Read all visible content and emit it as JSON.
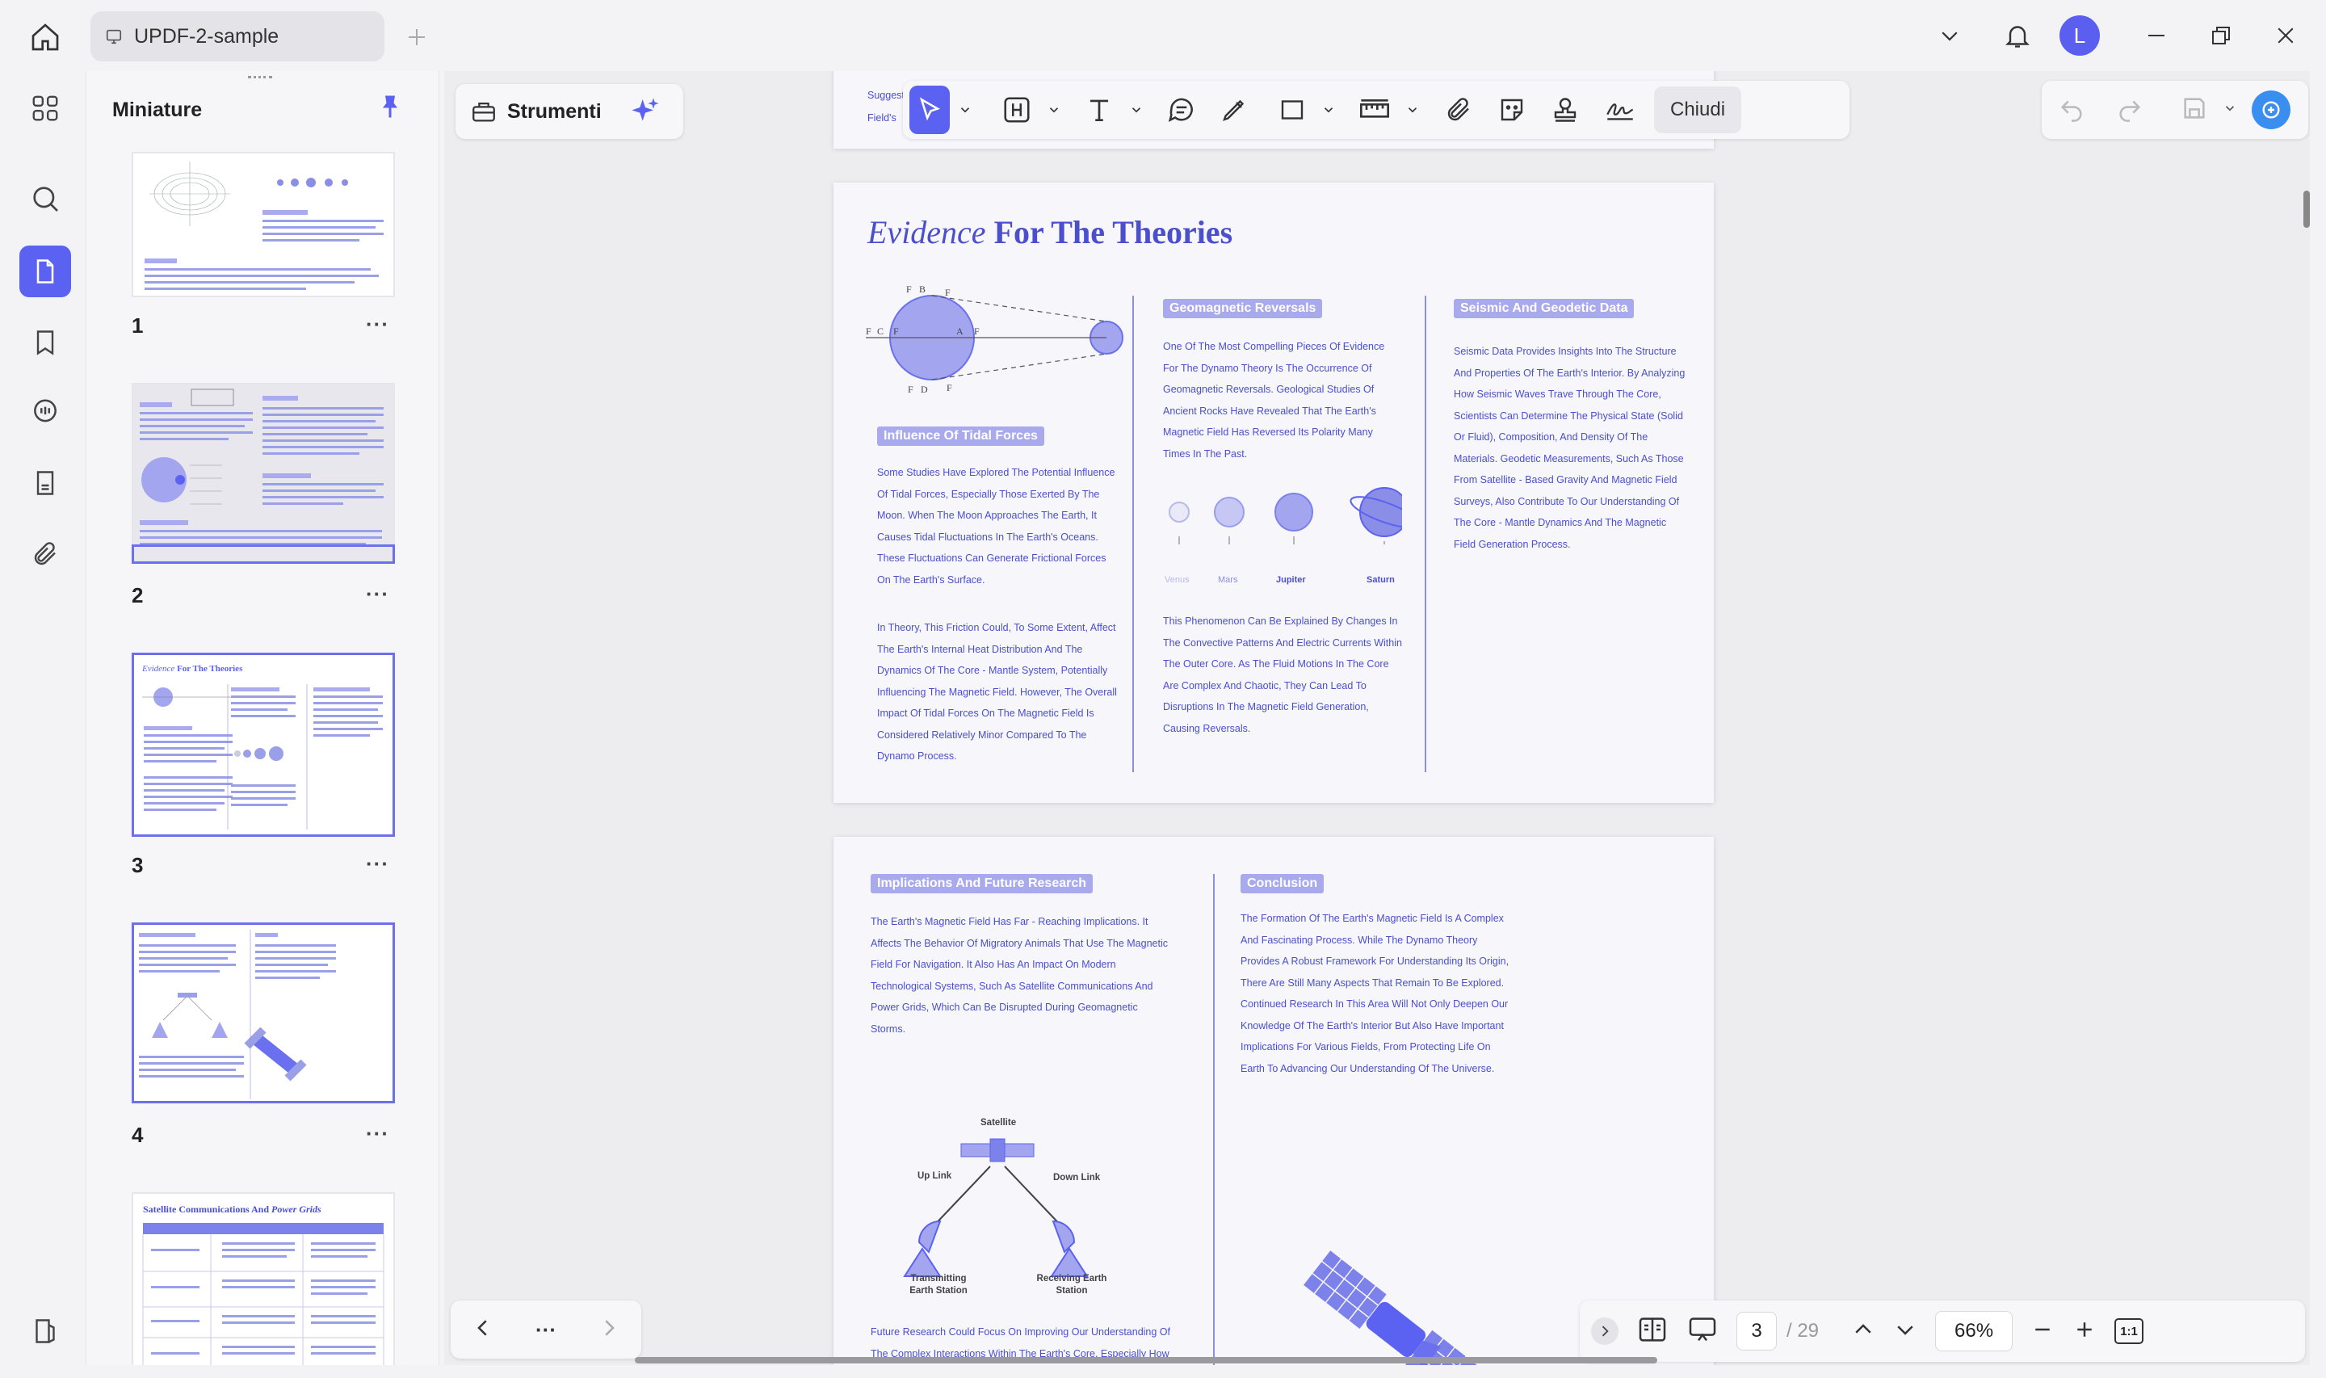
{
  "titlebar": {
    "tab_title": "UPDF-2-sample",
    "avatar_letter": "L"
  },
  "panel": {
    "title": "Miniature",
    "thumbnails": [
      {
        "number": "1",
        "more": "···"
      },
      {
        "number": "2",
        "more": "···"
      },
      {
        "number": "3",
        "more": "···"
      },
      {
        "number": "4",
        "more": "···"
      }
    ]
  },
  "toolbar": {
    "tools_label": "Strumenti",
    "close_label": "Chiudi"
  },
  "bottom": {
    "current_page": "3",
    "total_pages": "/ 29",
    "zoom": "66%",
    "more": "···",
    "fit_label": "1:1"
  },
  "page_top": {
    "text": "Suggesting That The Earth Was A Giant Magnet. Over Time, With The Development Of More Advanced Instruments And Theories, Our Understanding Of The Magnetic Field's"
  },
  "page3": {
    "title_italic": "Evidence",
    "title_bold": "For The Theories",
    "tidal_tag": "Influence Of Tidal Forces",
    "tidal_p1": "Some Studies Have Explored The Potential Influence Of Tidal Forces, Especially Those Exerted By The Moon. When The Moon Approaches The Earth, It Causes Tidal Fluctuations In The Earth's Oceans. These Fluctuations Can Generate Frictional Forces On The Earth's Surface.",
    "tidal_p2": "In Theory, This Friction Could, To Some Extent, Affect The Earth's Internal Heat Distribution And The Dynamics Of The Core - Mantle System, Potentially Influencing The Magnetic Field. However, The Overall Impact Of Tidal Forces On The Magnetic Field Is Considered Relatively Minor Compared To The Dynamo Process.",
    "geo_tag": "Geomagnetic Reversals",
    "geo_p1": "One Of The Most Compelling Pieces Of Evidence For The Dynamo Theory Is The Occurrence Of Geomagnetic Reversals. Geological Studies Of Ancient Rocks Have Revealed That The Earth's Magnetic Field Has Reversed Its Polarity Many Times In The Past.",
    "planets": [
      "Venus",
      "Mars",
      "Jupiter",
      "Saturn"
    ],
    "geo_p2": "This Phenomenon Can Be Explained By Changes In The Convective Patterns And Electric Currents Within The Outer Core. As The Fluid Motions In The Core Are Complex And Chaotic, They Can Lead To Disruptions In The Magnetic Field Generation, Causing Reversals.",
    "seismic_tag": "Seismic And Geodetic Data",
    "seismic_p": "Seismic Data Provides Insights Into The Structure And Properties Of The Earth's Interior. By Analyzing How Seismic Waves Trave Through The Core, Scientists Can Determine The Physical State (Solid Or Fluid), Composition, And Density Of The Materials. Geodetic Measurements, Such As Those From Satellite - Based Gravity And Magnetic Field Surveys, Also Contribute To Our Understanding Of The Core - Mantle Dynamics And The Magnetic Field Generation Process."
  },
  "page4": {
    "impl_tag": "Implications And Future Research",
    "impl_p": "The Earth's Magnetic Field Has Far - Reaching Implications. It Affects The Behavior Of Migratory Animals That Use The Magnetic Field For Navigation. It Also Has An Impact On Modern Technological Systems, Such As Satellite Communications And Power Grids, Which Can Be Disrupted During Geomagnetic Storms.",
    "diagram": {
      "satellite": "Satellite",
      "uplink": "Up Link",
      "downlink": "Down Link",
      "tx": "Transmitting Earth Station",
      "rx": "Receiving Earth Station"
    },
    "future_p": "Future Research Could Focus On Improving Our Understanding Of The Complex Interactions Within The Earth's Core, Especially How Small - Scale Processes Contribute To The Large - Scale Magnetic Field Generation. Additionally, Studying The Magnetic Fields Of Other Planets In The Solar System, Such As Mars And Jupiter, Can",
    "concl_tag": "Conclusion",
    "concl_p": "The Formation Of The Earth's Magnetic Field Is A Complex And Fascinating Process. While The Dynamo Theory Provides A Robust Framework For Understanding Its Origin, There Are Still Many Aspects That Remain To Be Explored. Continued Research In This Area Will Not Only Deepen Our Knowledge Of The Earth's Interior But Also Have Important Implications For Various Fields, From Protecting Life On Earth To Advancing Our Understanding Of The Universe."
  },
  "thumb5_title": "Satellite Communications And",
  "thumb5_title_italic": "Power Grids",
  "colors": {
    "accent": "#5b62f2",
    "page_text": "#4b4fce",
    "tag_bg": "#a9a9ee"
  }
}
